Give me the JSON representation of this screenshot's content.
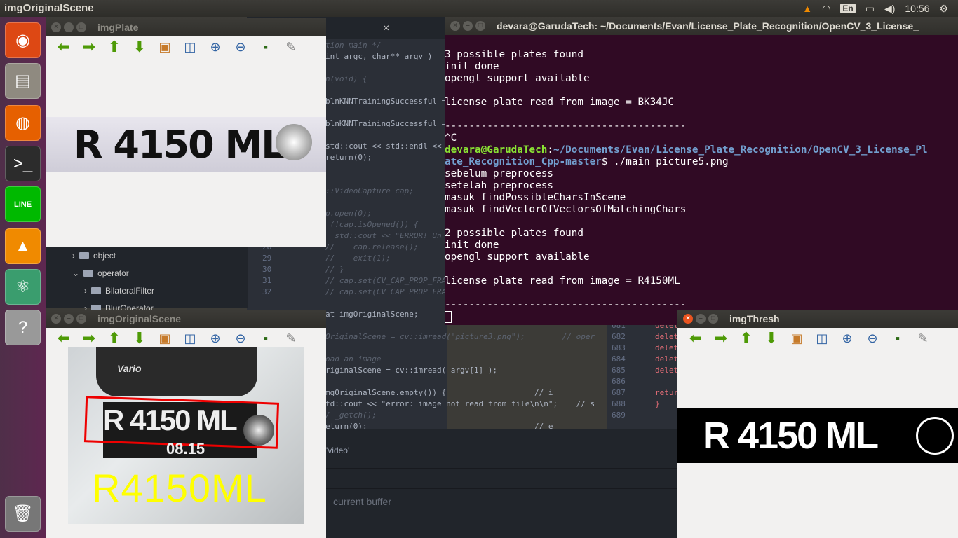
{
  "topbar": {
    "title": "imgOriginalScene",
    "keyboard": "En",
    "time": "10:56"
  },
  "launcher": {
    "items": [
      {
        "name": "ubuntu-dash",
        "glyph": "◉",
        "bg": "#dd4814"
      },
      {
        "name": "files",
        "glyph": "▤",
        "bg": "#8f8a80"
      },
      {
        "name": "firefox",
        "glyph": "◍",
        "bg": "#e66000"
      },
      {
        "name": "terminal",
        "glyph": ">_",
        "bg": "#2c2c2c"
      },
      {
        "name": "line",
        "glyph": "LINE",
        "bg": "#00b900"
      },
      {
        "name": "vlc",
        "glyph": "▲",
        "bg": "#f08a00"
      },
      {
        "name": "atom",
        "glyph": "⚛",
        "bg": "#3a9d6e"
      },
      {
        "name": "unknown-app",
        "glyph": "?",
        "bg": "#999"
      },
      {
        "name": "trash",
        "glyph": "🗑",
        "bg": "#777"
      }
    ]
  },
  "ide": {
    "tab_close": "×",
    "code": [
      {
        "n": "",
        "t": "tion main */",
        "c": "cm"
      },
      {
        "n": "",
        "t": "int argc, char** argv )",
        "c": ""
      },
      {
        "n": "",
        "t": "n(void) {",
        "c": "cm"
      },
      {
        "n": "",
        "t": "blnKNNTrainingSuccessful =",
        "c": ""
      },
      {
        "n": "",
        "t": "blnKNNTrainingSuccessful ==",
        "c": ""
      },
      {
        "n": "",
        "t": "std::cout << std::endl << s",
        "c": ""
      },
      {
        "n": "",
        "t": "return(0);",
        "c": ""
      },
      {
        "n": "",
        "t": "::VideoCapture cap;",
        "c": "cm"
      },
      {
        "n": "",
        "t": "p.open(0);",
        "c": "cm"
      },
      {
        "n": "",
        "t": " (!cap.isOpened()) {",
        "c": "cm"
      },
      {
        "n": "",
        "t": "  std::cout << \"ERROR! Un",
        "c": "cm"
      },
      {
        "n": "28",
        "t": "//    cap.release();",
        "c": "cm"
      },
      {
        "n": "29",
        "t": "//    exit(1);",
        "c": "cm"
      },
      {
        "n": "30",
        "t": "// }",
        "c": "cm"
      },
      {
        "n": "31",
        "t": "// cap.set(CV_CAP_PROP_FRAME_W",
        "c": "cm"
      },
      {
        "n": "32",
        "t": "// cap.set(CV_CAP_PROP_FRAME_H",
        "c": "cm"
      },
      {
        "n": "",
        "t": "at imgOriginalScene;",
        "c": ""
      },
      {
        "n": "",
        "t": "OriginalScene = cv::imread(\"picture3.png\");        // oper",
        "c": "cm"
      },
      {
        "n": "",
        "t": "oad an image",
        "c": "cm"
      },
      {
        "n": "",
        "t": "riginalScene = cv::imread( argv[1] );",
        "c": ""
      },
      {
        "n": "",
        "t": "mgOriginalScene.empty()) {                   // i",
        "c": ""
      },
      {
        "n": "",
        "t": "td::cout << \"error: image not read from file\\n\\n\";    // s",
        "c": ""
      },
      {
        "n": "",
        "t": "/ _getch();",
        "c": "cm"
      },
      {
        "n": "",
        "t": "eturn(0);                                    // e",
        "c": ""
      }
    ],
    "right_code": [
      {
        "n": "681",
        "t": "delet"
      },
      {
        "n": "682",
        "t": "delet"
      },
      {
        "n": "683",
        "t": "delet"
      },
      {
        "n": "684",
        "t": "delet"
      },
      {
        "n": "685",
        "t": "delet"
      },
      {
        "n": "686",
        "t": ""
      },
      {
        "n": "687",
        "t": "retur"
      },
      {
        "n": "688",
        "t": "}"
      },
      {
        "n": "689",
        "t": ""
      }
    ],
    "tree": [
      {
        "label": "object",
        "indent": 0,
        "open": false
      },
      {
        "label": "operator",
        "indent": 0,
        "open": true
      },
      {
        "label": "BilateralFilter",
        "indent": 1,
        "open": false
      },
      {
        "label": "BlurOperator",
        "indent": 1,
        "open": false
      }
    ],
    "find_video": "'video'",
    "find_placeholder": "current buffer"
  },
  "windows": {
    "plate": {
      "title": "imgPlate",
      "plate_text": "R 4150 ML"
    },
    "scene": {
      "title": "imgOriginalScene",
      "plate_text": "R 4150 ML",
      "sub_plate": "08.15",
      "brand": "Vario",
      "result": "R4150ML"
    },
    "thresh": {
      "title": "imgThresh",
      "plate_text": "R 4150 ML"
    }
  },
  "toolbar_icons": [
    "arrow-left-icon",
    "arrow-right-icon",
    "arrow-up-icon",
    "arrow-down-icon",
    "image-icon",
    "zoom-region-icon",
    "zoom-in-icon",
    "zoom-out-icon",
    "save-icon",
    "brush-icon"
  ],
  "terminal": {
    "title": "devara@GarudaTech: ~/Documents/Evan/License_Plate_Recognition/OpenCV_3_License_",
    "lines": [
      "3 possible plates found",
      "init done",
      "opengl support available",
      "",
      "license plate read from image = BK34JC",
      "",
      "----------------------------------------",
      "^C"
    ],
    "prompt_user": "devara@GarudaTech",
    "prompt_path_1": "~/Documents/Evan/License_Plate_Recognition/OpenCV_3_License_Pl",
    "prompt_path_2": "ate_Recognition_Cpp-master",
    "prompt_cmd": "$ ./main picture5.png",
    "lines2": [
      "sebelum preprocess",
      "setelah preprocess",
      "masuk findPossibleCharsInScene",
      "masuk findVectorOfVectorsOfMatchingChars",
      "",
      "2 possible plates found",
      "init done",
      "opengl support available",
      "",
      "license plate read from image = R4150ML",
      "",
      "----------------------------------------"
    ]
  }
}
